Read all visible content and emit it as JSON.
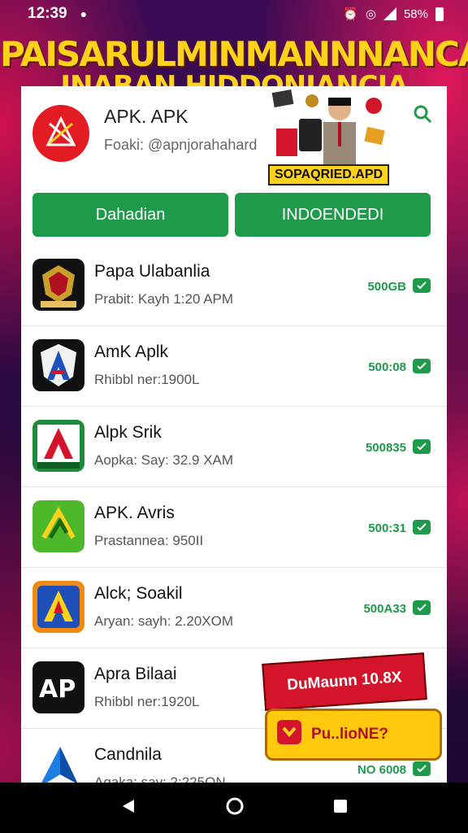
{
  "status": {
    "time": "12:39",
    "indicator": "●",
    "battery_text": "58%"
  },
  "banner": {
    "line1": "PAISARULMINMANNNANCA",
    "line2": "INABAN HIDDONIANCIA"
  },
  "header": {
    "app_name": "APK. APK",
    "handle": "Foaki: @apnjorahahard",
    "promo_label": "SOPAQRIED.APD"
  },
  "buttons": {
    "left_label": "Dahadian",
    "right_label": "INDOENDEDI"
  },
  "list": [
    {
      "title": "Papa Ulabanlia",
      "sub": "Prabit: Kayh 1:20 APM",
      "size": "500GB",
      "icon": "shield-app-icon"
    },
    {
      "title": "AmK Aplk",
      "sub": "Rhibbl ner:1900L",
      "size": "500:08",
      "icon": "letter-a-shield-icon"
    },
    {
      "title": "Alpk Srik",
      "sub": "Aopka: Say: 32.9 XAM",
      "size": "500835",
      "icon": "letter-a-green-icon"
    },
    {
      "title": "APK. Avris",
      "sub": "Prastannea: 950II",
      "size": "500:31",
      "icon": "delta-logo-icon"
    },
    {
      "title": "Alck; Soakil",
      "sub": "Aryan: sayh: 2.20XOM",
      "size": "500A33",
      "icon": "letter-a-blue-icon"
    },
    {
      "title": "Apra Bilaai",
      "sub": "Rhibbl ner:1920L",
      "size": "",
      "icon": "ap-logo-icon"
    },
    {
      "title": "Candnila",
      "sub": "Agaka: say: 2:225ON",
      "size": "NO 6008",
      "icon": "arrow-logo-icon"
    }
  ],
  "promo": {
    "top_text": "DuMaunn 10.8X",
    "button_text": "Pu..lioNE?"
  },
  "colors": {
    "accent_green": "#1e9a4a",
    "brand_red": "#e31b23",
    "banner_yellow": "#ffd21a"
  }
}
